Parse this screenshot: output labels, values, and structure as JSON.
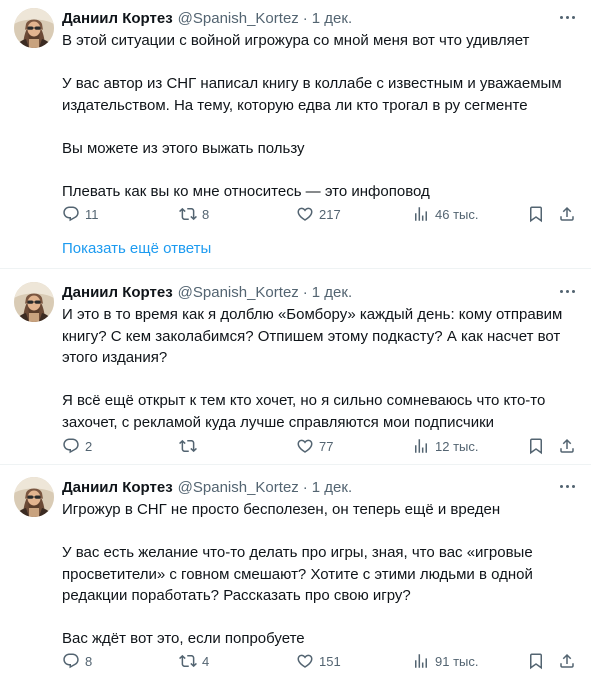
{
  "tweets": [
    {
      "author": "Даниил Кортез",
      "handle": "@Spanish_Kortez",
      "separator": "·",
      "date": "1 дек.",
      "paragraphs": [
        "В этой ситуации с войной игрожура со мной меня вот что удивляет",
        "У вас автор из СНГ написал книгу в коллабе с известным и уважаемым издательством. На тему, которую едва ли кто трогал в ру сегменте",
        "Вы можете из этого выжать пользу",
        "Плевать как вы ко мне относитесь — это инфоповод"
      ],
      "replies": "11",
      "retweets": "8",
      "likes": "217",
      "views": "46 тыс."
    },
    {
      "author": "Даниил Кортез",
      "handle": "@Spanish_Kortez",
      "separator": "·",
      "date": "1 дек.",
      "paragraphs": [
        "И это в то время как я долблю «Бомбору» каждый день: кому отправим книгу? С кем заколабимся? Отпишем этому подкасту? А как насчет вот этого издания?",
        "Я всё ещё открыт к тем кто хочет, но я сильно сомневаюсь что кто-то захочет, с рекламой куда лучше справляются мои подписчики"
      ],
      "replies": "2",
      "retweets": "",
      "likes": "77",
      "views": "12 тыс."
    },
    {
      "author": "Даниил Кортез",
      "handle": "@Spanish_Kortez",
      "separator": "·",
      "date": "1 дек.",
      "paragraphs": [
        "Игрожур в СНГ не просто бесполезен, он теперь ещё и вреден",
        "У вас есть желание что-то делать про игры, зная, что вас «игровые просветители» с говном смешают? Хотите с этими людьми в одной редакции поработать? Рассказать про свою игру?",
        "Вас ждёт вот это, если попробуете"
      ],
      "replies": "8",
      "retweets": "4",
      "likes": "151",
      "views": "91 тыс."
    }
  ],
  "show_more_replies": "Показать ещё ответы",
  "icons": {
    "reply": "reply-icon",
    "retweet": "retweet-icon",
    "like": "like-icon",
    "views": "views-icon",
    "bookmark": "bookmark-icon",
    "share": "share-icon",
    "more": "more-icon"
  },
  "colors": {
    "text": "#0f1419",
    "secondary": "#536471",
    "link": "#1d9bf0",
    "divider": "#eff3f4"
  }
}
